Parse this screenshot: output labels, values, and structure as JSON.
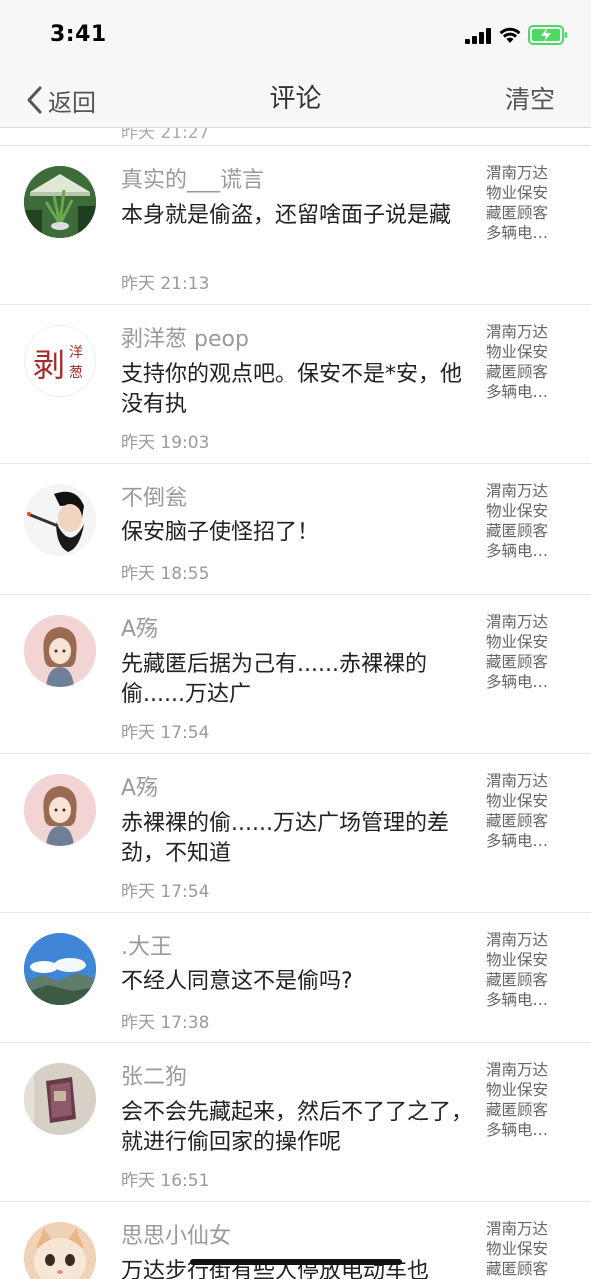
{
  "status_bar": {
    "time": "3:41"
  },
  "nav": {
    "back_label": "返回",
    "title": "评论",
    "clear_label": "清空"
  },
  "partial_time": "昨天 21:27",
  "article_ref": {
    "line1": "渭南万达",
    "line2": "物业保安",
    "line3": "藏匿顾客",
    "line4": "多辆电…"
  },
  "comments": [
    {
      "user": "真实的___谎言",
      "text": "本身就是偷盗，还留啥面子说是藏",
      "time": "昨天 21:13"
    },
    {
      "user": "剥洋葱 peop",
      "text": "支持你的观点吧。保安不是*安，他没有执",
      "time": "昨天 19:03"
    },
    {
      "user": "不倒瓮",
      "text": "保安脑子使怪招了！",
      "time": "昨天 18:55"
    },
    {
      "user": "A殇",
      "text": "先藏匿后据为己有......赤裸裸的偷......万达广",
      "time": "昨天 17:54"
    },
    {
      "user": "A殇",
      "text": "赤裸裸的偷......万达广场管理的差劲，不知道",
      "time": "昨天 17:54"
    },
    {
      "user": ".大王",
      "text": "不经人同意这不是偷吗?",
      "time": "昨天 17:38"
    },
    {
      "user": "张二狗",
      "text": "会不会先藏起来，然后不了了之了，就进行偷回家的操作呢",
      "time": "昨天 16:51"
    },
    {
      "user": "思思小仙女",
      "text": "万达步行街有些人停放电动车也",
      "time": ""
    }
  ],
  "avatar_text": {
    "char_main": "剥",
    "char_top": "洋",
    "char_bottom": "葱"
  },
  "colors": {
    "battery_green": "#4cd964",
    "text_gray": "#9a9a9a"
  }
}
